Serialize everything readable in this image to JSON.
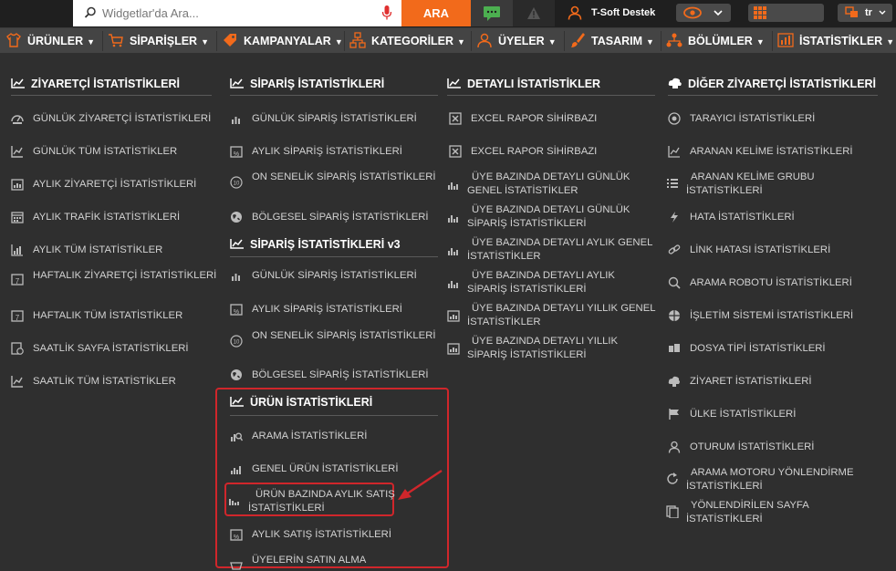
{
  "topbar": {
    "search_placeholder": "Widgetlar'da Ara...",
    "search_button": "ARA",
    "user_name": "T-Soft Destek",
    "language": "tr"
  },
  "nav": [
    {
      "label": "ÜRÜNLER",
      "icon": "shirt-icon"
    },
    {
      "label": "SİPARİŞLER",
      "icon": "cart-icon"
    },
    {
      "label": "KAMPANYALAR",
      "icon": "tag-icon"
    },
    {
      "label": "KATEGORİLER",
      "icon": "sitemap-icon"
    },
    {
      "label": "ÜYELER",
      "icon": "user-icon"
    },
    {
      "label": "TASARIM",
      "icon": "brush-icon"
    },
    {
      "label": "BÖLÜMLER",
      "icon": "sections-icon"
    },
    {
      "label": "İSTATİSTİKLER",
      "icon": "stats-icon"
    }
  ],
  "columns": {
    "visitor": {
      "title": "ZİYARETÇİ İSTATİSTİKLERİ",
      "items": [
        "GÜNLÜK ZİYARETÇİ İSTATİSTİKLERİ",
        "GÜNLÜK TÜM İSTATİSTİKLER",
        "AYLIK ZİYARETÇİ İSTATİSTİKLERİ",
        "AYLIK TRAFİK İSTATİSTİKLERİ",
        "AYLIK TÜM İSTATİSTİKLER",
        "HAFTALIK ZİYARETÇİ İSTATİSTİKLERİ",
        "HAFTALIK TÜM İSTATİSTİKLER",
        "SAATLİK SAYFA İSTATİSTİKLERİ",
        "SAATLİK TÜM İSTATİSTİKLER"
      ]
    },
    "order": {
      "title": "SİPARİŞ İSTATİSTİKLERİ",
      "items": [
        "GÜNLÜK SİPARİŞ İSTATİSTİKLERİ",
        "AYLIK SİPARİŞ İSTATİSTİKLERİ",
        "ON SENELİK SİPARİŞ İSTATİSTİKLERİ",
        "BÖLGESEL SİPARİŞ İSTATİSTİKLERİ"
      ]
    },
    "order_v3": {
      "title": "SİPARİŞ İSTATİSTİKLERİ v3",
      "items": [
        "GÜNLÜK SİPARİŞ İSTATİSTİKLERİ",
        "AYLIK SİPARİŞ İSTATİSTİKLERİ",
        "ON SENELİK SİPARİŞ İSTATİSTİKLERİ",
        "BÖLGESEL SİPARİŞ İSTATİSTİKLERİ"
      ]
    },
    "product": {
      "title": "ÜRÜN İSTATİSTİKLERİ",
      "items": [
        "ARAMA İSTATİSTİKLERİ",
        "GENEL ÜRÜN İSTATİSTİKLERİ",
        "ÜRÜN BAZINDA AYLIK SATIŞ İSTATİSTİKLERİ",
        "AYLIK SATIŞ İSTATİSTİKLERİ",
        "ÜYELERİN SATIN ALMA"
      ]
    },
    "detailed": {
      "title": "DETAYLI İSTATİSTİKLER",
      "items": [
        "EXCEL RAPOR SİHİRBAZI",
        "EXCEL RAPOR SİHİRBAZI",
        "ÜYE BAZINDA DETAYLI GÜNLÜK GENEL İSTATİSTİKLER",
        "ÜYE BAZINDA DETAYLI GÜNLÜK SİPARİŞ İSTATİSTİKLERİ",
        "ÜYE BAZINDA DETAYLI AYLIK GENEL İSTATİSTİKLER",
        "ÜYE BAZINDA DETAYLI AYLIK SİPARİŞ İSTATİSTİKLERİ",
        "ÜYE BAZINDA DETAYLI YILLIK GENEL İSTATİSTİKLER",
        "ÜYE BAZINDA DETAYLI YILLIK SİPARİŞ İSTATİSTİKLERİ"
      ]
    },
    "other": {
      "title": "DİĞER ZİYARETÇİ İSTATİSTİKLERİ",
      "items": [
        "TARAYICI İSTATİSTİKLERİ",
        "ARANAN KELİME İSTATİSTİKLERİ",
        "ARANAN KELİME GRUBU İSTATİSTİKLERİ",
        "HATA İSTATİSTİKLERİ",
        "LİNK HATASI İSTATİSTİKLERİ",
        "ARAMA ROBOTU İSTATİSTİKLERİ",
        "İŞLETİM SİSTEMİ İSTATİSTİKLERİ",
        "DOSYA TİPİ İSTATİSTİKLERİ",
        "ZİYARET İSTATİSTİKLERİ",
        "ÜLKE İSTATİSTİKLERİ",
        "OTURUM İSTATİSTİKLERİ",
        "ARAMA MOTORU YÖNLENDİRME İSTATİSTİKLERİ",
        "YÖNLENDİRİLEN SAYFA İSTATİSTİKLERİ"
      ]
    }
  },
  "colors": {
    "accent": "#f26a1b",
    "highlight": "#d0262b",
    "background": "#2f2f2f",
    "navbar": "#444444"
  }
}
